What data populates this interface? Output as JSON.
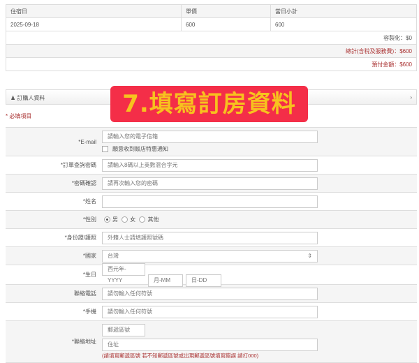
{
  "price_table": {
    "headers": [
      "住宿日",
      "單價",
      "當日小計"
    ],
    "rows": [
      [
        "2025-09-18",
        "600",
        "600"
      ]
    ],
    "discount": "容製化：$0",
    "total": "總計(含稅及服務費)：$600",
    "prepay": "預付金額：$600"
  },
  "section": {
    "title": "訂購人資料",
    "required_note": "* 必填項目"
  },
  "banner": "7.填寫訂房資料",
  "form": {
    "email": {
      "label": "*E-mail",
      "placeholder": "請輸入您的電子信箱",
      "checkbox": "願意收到飯店特惠通知"
    },
    "query_pw": {
      "label": "*訂單查詢密碼",
      "placeholder": "請輸入8碼以上英數混合字元"
    },
    "confirm_pw": {
      "label": "*密碼確認",
      "placeholder": "請再次輸入您的密碼"
    },
    "name": {
      "label": "*姓名",
      "placeholder": ""
    },
    "gender": {
      "label": "*性別",
      "options": [
        "男",
        "女",
        "其他"
      ],
      "selected": "男"
    },
    "id": {
      "label": "*身份證/護照",
      "placeholder": "外籍人士請填護照號碼"
    },
    "country": {
      "label": "*國家",
      "value": "台灣"
    },
    "birthday": {
      "label": "*生日",
      "year": "西元年-YYYY",
      "month": "月-MM",
      "day": "日-DD"
    },
    "phone": {
      "label": "聯絡電話",
      "placeholder": "請勿輸入任何符號"
    },
    "mobile": {
      "label": "*手機",
      "placeholder": "請勿輸入任何符號"
    },
    "address": {
      "label": "*聯絡地址",
      "zip": "郵遞區號",
      "addr": "住址",
      "hint": "(請填寫郵遞區號 若不知郵遞區號或出現郵遞區號填寫錯誤 請打000)"
    }
  }
}
